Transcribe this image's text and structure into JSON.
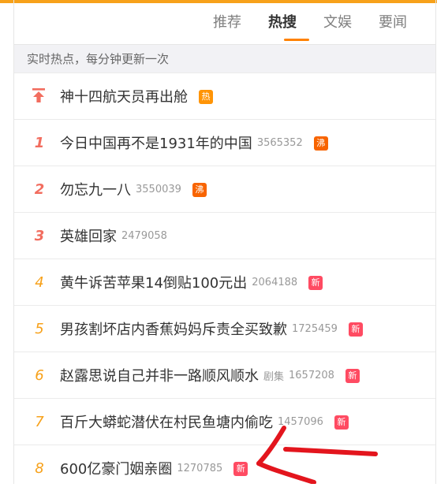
{
  "tabs": [
    {
      "label": "推荐",
      "active": false
    },
    {
      "label": "热搜",
      "active": true
    },
    {
      "label": "文娱",
      "active": false
    },
    {
      "label": "要闻",
      "active": false
    }
  ],
  "subheader": "实时热点，每分钟更新一次",
  "items": [
    {
      "rank": "",
      "pinned": true,
      "title": "神十四航天员再出舱",
      "count": "",
      "badge": "热",
      "badge_type": "warm"
    },
    {
      "rank": "1",
      "title": "今日中国再不是1931年的中国",
      "count": "3565352",
      "badge": "沸",
      "badge_type": "boil"
    },
    {
      "rank": "2",
      "title": "勿忘九一八",
      "count": "3550039",
      "badge": "沸",
      "badge_type": "boil"
    },
    {
      "rank": "3",
      "title": "英雄回家",
      "count": "2479058",
      "badge": "",
      "badge_type": ""
    },
    {
      "rank": "4",
      "title": "黄牛诉苦苹果14倒贴100元出",
      "count": "2064188",
      "badge": "新",
      "badge_type": "new"
    },
    {
      "rank": "5",
      "title": "男孩割坏店内香蕉妈妈斥责全买致歉",
      "count": "1725459",
      "badge": "新",
      "badge_type": "new"
    },
    {
      "rank": "6",
      "title": "赵露思说自己并非一路顺风顺水",
      "tag": "剧集",
      "count": "1657208",
      "badge": "新",
      "badge_type": "new"
    },
    {
      "rank": "7",
      "title": "百斤大蟒蛇潜伏在村民鱼塘内偷吃",
      "count": "1457096",
      "badge": "新",
      "badge_type": "new"
    },
    {
      "rank": "8",
      "title": "600亿豪门姻亲圈",
      "count": "1270785",
      "badge": "新",
      "badge_type": "new"
    }
  ],
  "colors": {
    "accent": "#ff8200",
    "rank_top": "#f26d5f",
    "annotation": "#e3151d"
  },
  "icons": {
    "pinned": "pin-top-arrow-icon",
    "annotation": "red-arrow-annotation"
  }
}
